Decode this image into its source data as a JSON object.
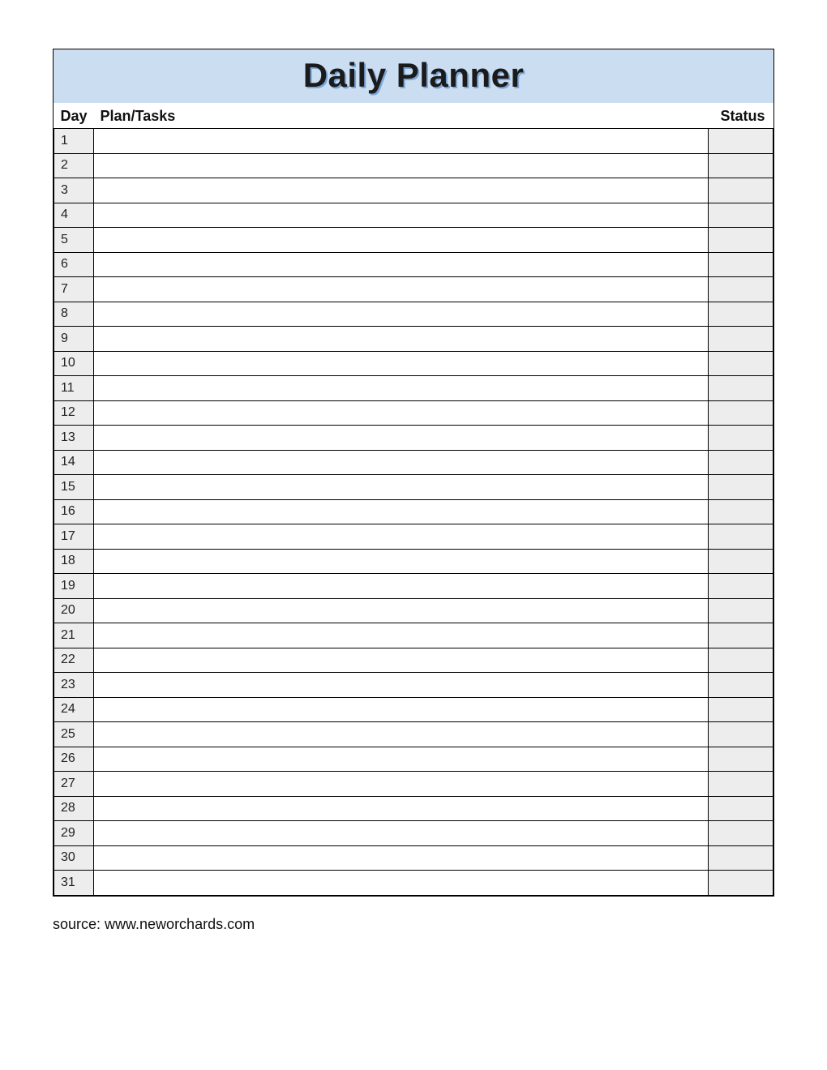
{
  "title": "Daily Planner",
  "headers": {
    "day": "Day",
    "plan": "Plan/Tasks",
    "status": "Status"
  },
  "rows": [
    {
      "day": "1",
      "task": "",
      "status": ""
    },
    {
      "day": "2",
      "task": "",
      "status": ""
    },
    {
      "day": "3",
      "task": "",
      "status": ""
    },
    {
      "day": "4",
      "task": "",
      "status": ""
    },
    {
      "day": "5",
      "task": "",
      "status": ""
    },
    {
      "day": "6",
      "task": "",
      "status": ""
    },
    {
      "day": "7",
      "task": "",
      "status": ""
    },
    {
      "day": "8",
      "task": "",
      "status": ""
    },
    {
      "day": "9",
      "task": "",
      "status": ""
    },
    {
      "day": "10",
      "task": "",
      "status": ""
    },
    {
      "day": "11",
      "task": "",
      "status": ""
    },
    {
      "day": "12",
      "task": "",
      "status": ""
    },
    {
      "day": "13",
      "task": "",
      "status": ""
    },
    {
      "day": "14",
      "task": "",
      "status": ""
    },
    {
      "day": "15",
      "task": "",
      "status": ""
    },
    {
      "day": "16",
      "task": "",
      "status": ""
    },
    {
      "day": "17",
      "task": "",
      "status": ""
    },
    {
      "day": "18",
      "task": "",
      "status": ""
    },
    {
      "day": "19",
      "task": "",
      "status": ""
    },
    {
      "day": "20",
      "task": "",
      "status": ""
    },
    {
      "day": "21",
      "task": "",
      "status": ""
    },
    {
      "day": "22",
      "task": "",
      "status": ""
    },
    {
      "day": "23",
      "task": "",
      "status": ""
    },
    {
      "day": "24",
      "task": "",
      "status": ""
    },
    {
      "day": "25",
      "task": "",
      "status": ""
    },
    {
      "day": "26",
      "task": "",
      "status": ""
    },
    {
      "day": "27",
      "task": "",
      "status": ""
    },
    {
      "day": "28",
      "task": "",
      "status": ""
    },
    {
      "day": "29",
      "task": "",
      "status": ""
    },
    {
      "day": "30",
      "task": "",
      "status": ""
    },
    {
      "day": "31",
      "task": "",
      "status": ""
    }
  ],
  "source": "source: www.neworchards.com"
}
